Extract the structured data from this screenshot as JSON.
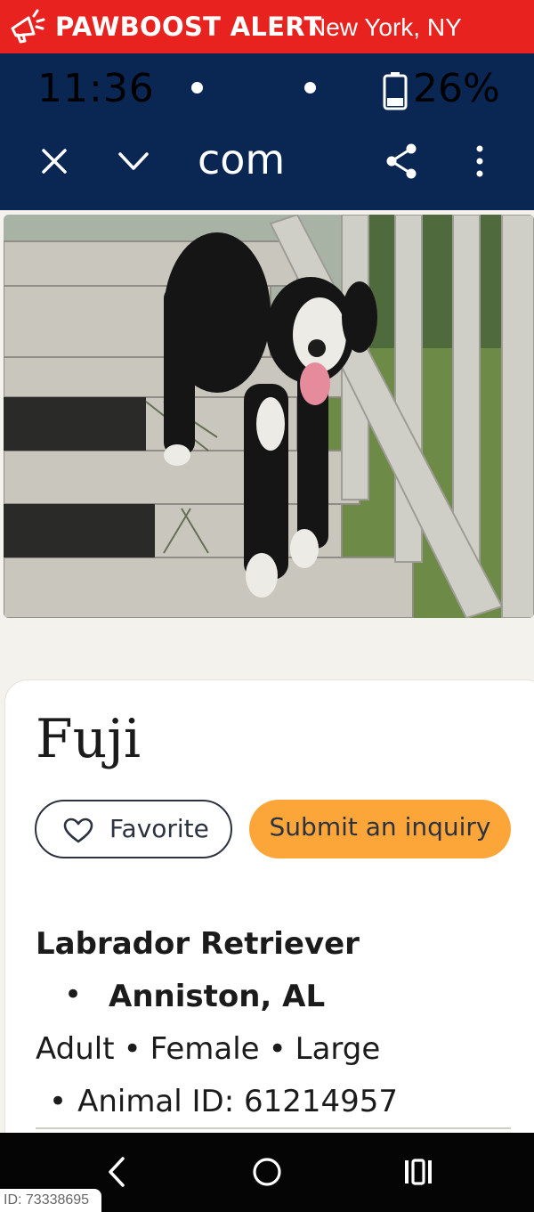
{
  "alert_bar": {
    "brand": "PAWBOOST ALERT",
    "location": "New York, NY",
    "icon": "megaphone-icon"
  },
  "status_bar": {
    "time": "11:36",
    "battery": "26%"
  },
  "browser": {
    "url": "com",
    "close_icon": "close-icon",
    "dropdown_icon": "chevron-down-icon",
    "share_icon": "share-icon",
    "menu_icon": "kebab-menu-icon"
  },
  "pet": {
    "name": "Fuji",
    "favorite_label": "Favorite",
    "inquiry_label": "Submit an inquiry",
    "breed": "Labrador Retriever",
    "location": "Anniston, AL",
    "age": "Adult",
    "sex": "Female",
    "size": "Large",
    "animal_id": "Animal ID: 61214957"
  },
  "nav": {
    "back_icon": "back-icon",
    "home_icon": "home-icon",
    "recents_icon": "recents-icon"
  },
  "footer": {
    "id_tag": "ID: 73338695"
  },
  "colors": {
    "alert_red": "#e8231f",
    "status_navy": "#0a2653",
    "inquiry_orange": "#fca63a",
    "page_bg": "#f4f2ec"
  }
}
